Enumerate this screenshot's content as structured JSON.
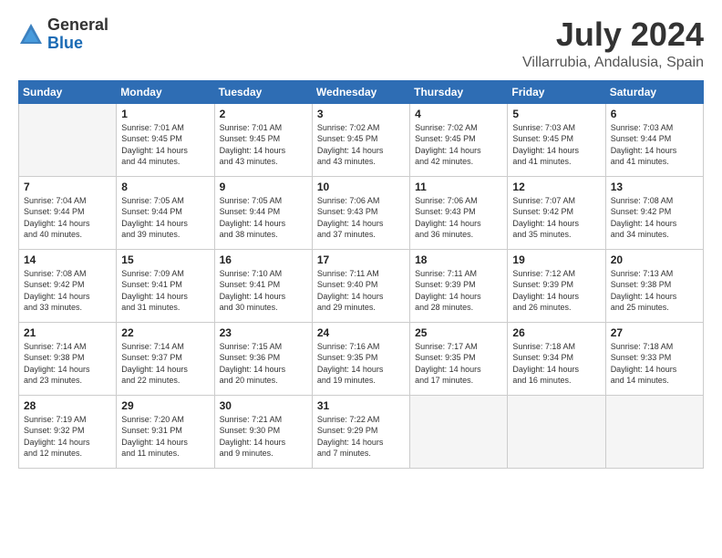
{
  "logo": {
    "general": "General",
    "blue": "Blue"
  },
  "header": {
    "month": "July 2024",
    "location": "Villarrubia, Andalusia, Spain"
  },
  "weekdays": [
    "Sunday",
    "Monday",
    "Tuesday",
    "Wednesday",
    "Thursday",
    "Friday",
    "Saturday"
  ],
  "weeks": [
    [
      {
        "day": "",
        "empty": true
      },
      {
        "day": "1",
        "sunrise": "7:01 AM",
        "sunset": "9:45 PM",
        "daylight": "14 hours and 44 minutes."
      },
      {
        "day": "2",
        "sunrise": "7:01 AM",
        "sunset": "9:45 PM",
        "daylight": "14 hours and 43 minutes."
      },
      {
        "day": "3",
        "sunrise": "7:02 AM",
        "sunset": "9:45 PM",
        "daylight": "14 hours and 43 minutes."
      },
      {
        "day": "4",
        "sunrise": "7:02 AM",
        "sunset": "9:45 PM",
        "daylight": "14 hours and 42 minutes."
      },
      {
        "day": "5",
        "sunrise": "7:03 AM",
        "sunset": "9:45 PM",
        "daylight": "14 hours and 41 minutes."
      },
      {
        "day": "6",
        "sunrise": "7:03 AM",
        "sunset": "9:44 PM",
        "daylight": "14 hours and 41 minutes."
      }
    ],
    [
      {
        "day": "7",
        "sunrise": "7:04 AM",
        "sunset": "9:44 PM",
        "daylight": "14 hours and 40 minutes."
      },
      {
        "day": "8",
        "sunrise": "7:05 AM",
        "sunset": "9:44 PM",
        "daylight": "14 hours and 39 minutes."
      },
      {
        "day": "9",
        "sunrise": "7:05 AM",
        "sunset": "9:44 PM",
        "daylight": "14 hours and 38 minutes."
      },
      {
        "day": "10",
        "sunrise": "7:06 AM",
        "sunset": "9:43 PM",
        "daylight": "14 hours and 37 minutes."
      },
      {
        "day": "11",
        "sunrise": "7:06 AM",
        "sunset": "9:43 PM",
        "daylight": "14 hours and 36 minutes."
      },
      {
        "day": "12",
        "sunrise": "7:07 AM",
        "sunset": "9:42 PM",
        "daylight": "14 hours and 35 minutes."
      },
      {
        "day": "13",
        "sunrise": "7:08 AM",
        "sunset": "9:42 PM",
        "daylight": "14 hours and 34 minutes."
      }
    ],
    [
      {
        "day": "14",
        "sunrise": "7:08 AM",
        "sunset": "9:42 PM",
        "daylight": "14 hours and 33 minutes."
      },
      {
        "day": "15",
        "sunrise": "7:09 AM",
        "sunset": "9:41 PM",
        "daylight": "14 hours and 31 minutes."
      },
      {
        "day": "16",
        "sunrise": "7:10 AM",
        "sunset": "9:41 PM",
        "daylight": "14 hours and 30 minutes."
      },
      {
        "day": "17",
        "sunrise": "7:11 AM",
        "sunset": "9:40 PM",
        "daylight": "14 hours and 29 minutes."
      },
      {
        "day": "18",
        "sunrise": "7:11 AM",
        "sunset": "9:39 PM",
        "daylight": "14 hours and 28 minutes."
      },
      {
        "day": "19",
        "sunrise": "7:12 AM",
        "sunset": "9:39 PM",
        "daylight": "14 hours and 26 minutes."
      },
      {
        "day": "20",
        "sunrise": "7:13 AM",
        "sunset": "9:38 PM",
        "daylight": "14 hours and 25 minutes."
      }
    ],
    [
      {
        "day": "21",
        "sunrise": "7:14 AM",
        "sunset": "9:38 PM",
        "daylight": "14 hours and 23 minutes."
      },
      {
        "day": "22",
        "sunrise": "7:14 AM",
        "sunset": "9:37 PM",
        "daylight": "14 hours and 22 minutes."
      },
      {
        "day": "23",
        "sunrise": "7:15 AM",
        "sunset": "9:36 PM",
        "daylight": "14 hours and 20 minutes."
      },
      {
        "day": "24",
        "sunrise": "7:16 AM",
        "sunset": "9:35 PM",
        "daylight": "14 hours and 19 minutes."
      },
      {
        "day": "25",
        "sunrise": "7:17 AM",
        "sunset": "9:35 PM",
        "daylight": "14 hours and 17 minutes."
      },
      {
        "day": "26",
        "sunrise": "7:18 AM",
        "sunset": "9:34 PM",
        "daylight": "14 hours and 16 minutes."
      },
      {
        "day": "27",
        "sunrise": "7:18 AM",
        "sunset": "9:33 PM",
        "daylight": "14 hours and 14 minutes."
      }
    ],
    [
      {
        "day": "28",
        "sunrise": "7:19 AM",
        "sunset": "9:32 PM",
        "daylight": "14 hours and 12 minutes."
      },
      {
        "day": "29",
        "sunrise": "7:20 AM",
        "sunset": "9:31 PM",
        "daylight": "14 hours and 11 minutes."
      },
      {
        "day": "30",
        "sunrise": "7:21 AM",
        "sunset": "9:30 PM",
        "daylight": "14 hours and 9 minutes."
      },
      {
        "day": "31",
        "sunrise": "7:22 AM",
        "sunset": "9:29 PM",
        "daylight": "14 hours and 7 minutes."
      },
      {
        "day": "",
        "empty": true
      },
      {
        "day": "",
        "empty": true
      },
      {
        "day": "",
        "empty": true
      }
    ]
  ],
  "labels": {
    "sunrise": "Sunrise:",
    "sunset": "Sunset:",
    "daylight": "Daylight:"
  }
}
